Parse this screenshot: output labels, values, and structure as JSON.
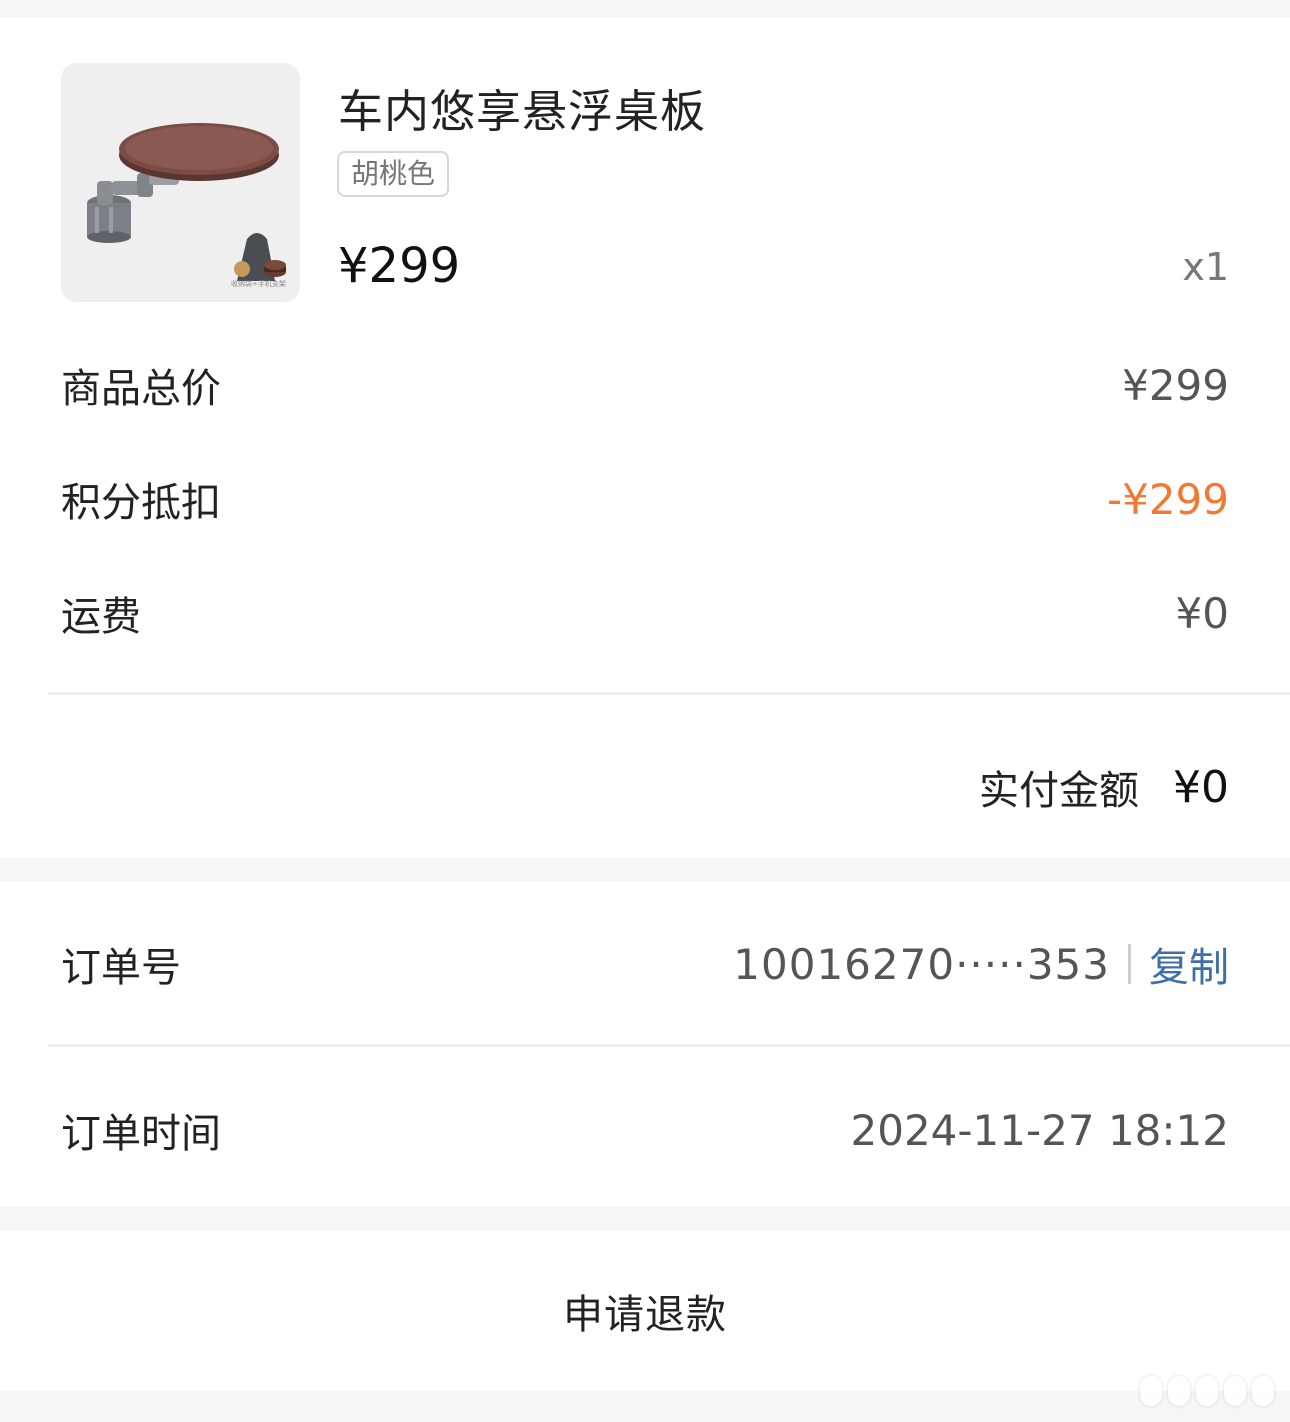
{
  "product": {
    "name": "车内悠享悬浮桌板",
    "variant": "胡桃色",
    "price": "¥299",
    "quantity": "x1",
    "image_icon": "tray-table-product-image",
    "image_caption": "收纳袋+手机支架"
  },
  "summary": {
    "subtotal_label": "商品总价",
    "subtotal_value": "¥299",
    "points_label": "积分抵扣",
    "points_value": "-¥299",
    "shipping_label": "运费",
    "shipping_value": "¥0",
    "paid_label": "实付金额",
    "paid_value": "¥0"
  },
  "order": {
    "number_label": "订单号",
    "number_value": "10016270·····353",
    "copy_label": "复制",
    "time_label": "订单时间",
    "time_value": "2024-11-27 18:12"
  },
  "actions": {
    "refund_label": "申请退款"
  },
  "colors": {
    "accent_orange": "#f07a33",
    "link_blue": "#3f6fa8",
    "page_bg": "#f4f6f8"
  }
}
